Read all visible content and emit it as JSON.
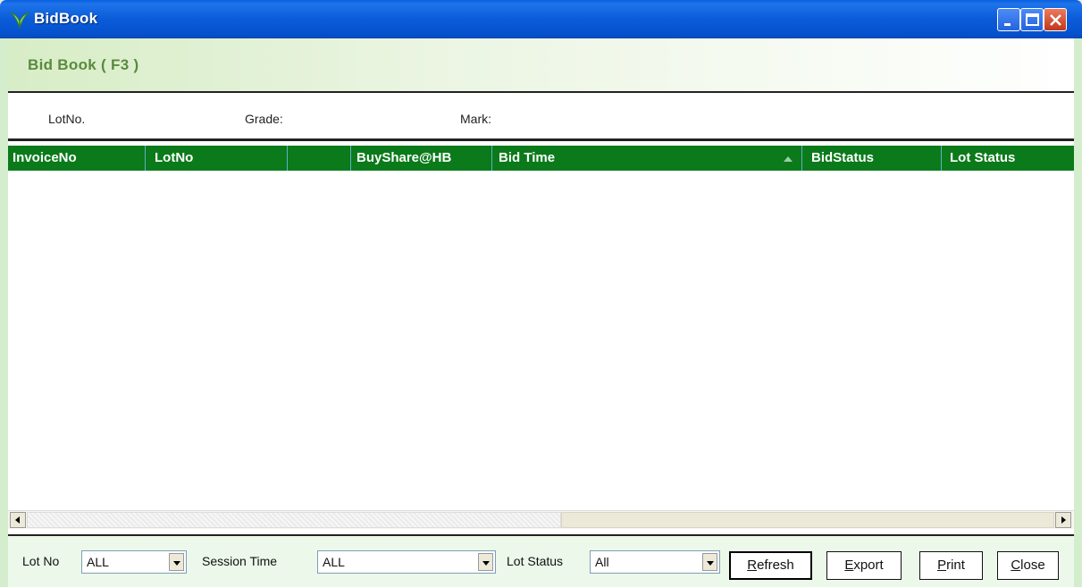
{
  "window": {
    "title": "BidBook",
    "icon": "app-logo-icon",
    "controls": [
      "minimize-icon",
      "maximize-icon",
      "close-icon"
    ]
  },
  "header": {
    "title": "Bid Book ( F3 )"
  },
  "info": {
    "lotno_label": "LotNo.",
    "grade_label": "Grade:",
    "mark_label": "Mark:"
  },
  "grid": {
    "columns": [
      {
        "label": "InvoiceNo"
      },
      {
        "label": "LotNo"
      },
      {
        "label": ""
      },
      {
        "label": "BuyShare@HB"
      },
      {
        "label": "Bid Time",
        "sorted": "ascending"
      },
      {
        "label": "BidStatus"
      },
      {
        "label": "Lot Status"
      }
    ],
    "rows": [],
    "header_color": "#0b7a1a"
  },
  "filters": {
    "lot_no": {
      "label": "Lot No",
      "value": "ALL"
    },
    "session_time": {
      "label": "Session Time",
      "value": "ALL"
    },
    "lot_status": {
      "label": "Lot Status",
      "value": "All"
    }
  },
  "buttons": {
    "refresh": {
      "pre": "",
      "u": "R",
      "post": "efresh"
    },
    "export": {
      "pre": "",
      "u": "E",
      "post": "xport"
    },
    "print": {
      "pre": "",
      "u": "P",
      "post": "rint"
    },
    "close": {
      "pre": "",
      "u": "C",
      "post": "lose"
    }
  }
}
